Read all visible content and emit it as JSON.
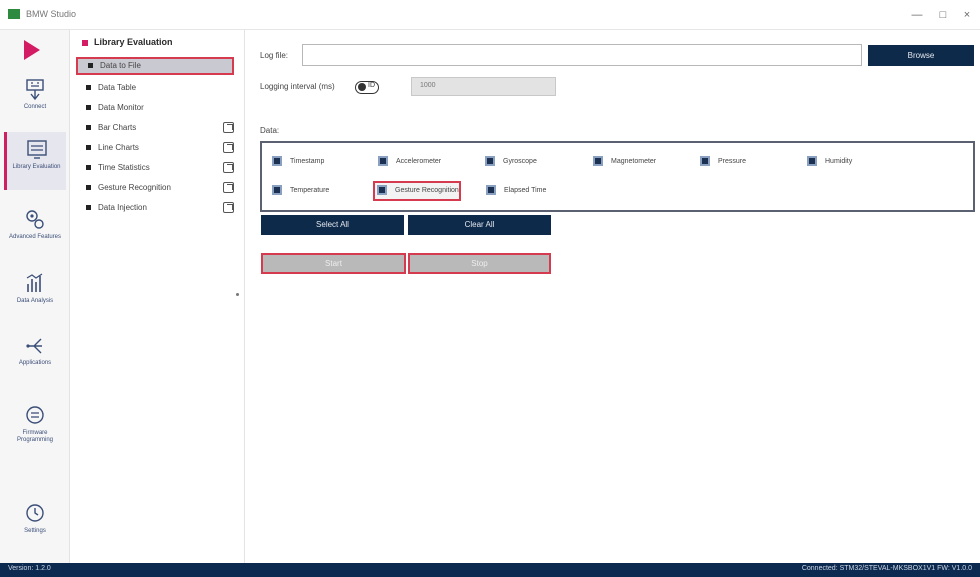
{
  "window": {
    "title": "BMW Studio"
  },
  "nav": {
    "items": [
      {
        "label": "Connect",
        "icon": "connect-icon"
      },
      {
        "label": "Library Evaluation",
        "icon": "library-evaluation-icon",
        "active": true
      },
      {
        "label": "Advanced Features",
        "icon": "advanced-features-icon"
      },
      {
        "label": "Data Analysis",
        "icon": "data-analysis-icon"
      },
      {
        "label": "Applications",
        "icon": "applications-icon"
      },
      {
        "label": "Firmware Programming",
        "icon": "firmware-programming-icon"
      },
      {
        "label": "Settings",
        "icon": "settings-icon"
      }
    ]
  },
  "tree": {
    "root": "Library Evaluation",
    "items": [
      {
        "label": "Data to File",
        "selected": true,
        "external": false
      },
      {
        "label": "Data Table",
        "external": false
      },
      {
        "label": "Data Monitor",
        "external": false
      },
      {
        "label": "Bar Charts",
        "external": true
      },
      {
        "label": "Line Charts",
        "external": true
      },
      {
        "label": "Time Statistics",
        "external": true
      },
      {
        "label": "Gesture Recognition",
        "external": true
      },
      {
        "label": "Data Injection",
        "external": true
      }
    ]
  },
  "form": {
    "log_file_label": "Log file:",
    "log_file_value": "",
    "browse_label": "Browse",
    "logging_interval_label": "Logging interval (ms)",
    "interval_toggle_text": "ID",
    "interval_placeholder": "1000",
    "data_label": "Data:"
  },
  "data_options": [
    {
      "label": "Timestamp",
      "checked": true,
      "highlighted": false
    },
    {
      "label": "Accelerometer",
      "checked": true,
      "highlighted": false
    },
    {
      "label": "Gyroscope",
      "checked": true,
      "highlighted": false
    },
    {
      "label": "Magnetometer",
      "checked": true,
      "highlighted": false
    },
    {
      "label": "Pressure",
      "checked": true,
      "highlighted": false
    },
    {
      "label": "Humidity",
      "checked": true,
      "highlighted": false
    },
    {
      "label": "Temperature",
      "checked": true,
      "highlighted": false
    },
    {
      "label": "Gesture Recognition",
      "checked": true,
      "highlighted": true
    },
    {
      "label": "Elapsed Time",
      "checked": true,
      "highlighted": false
    }
  ],
  "buttons": {
    "select_all": "Select All",
    "clear_all": "Clear All",
    "start": "Start",
    "stop": "Stop"
  },
  "status": {
    "version": "Version: 1.2.0",
    "connection": "Connected: STM32/STEVAL-MKSBOX1V1 FW: V1.0.0"
  },
  "colors": {
    "accent": "#d31c63",
    "navy": "#0e2a4a",
    "highlight_border": "#d63a4e"
  }
}
